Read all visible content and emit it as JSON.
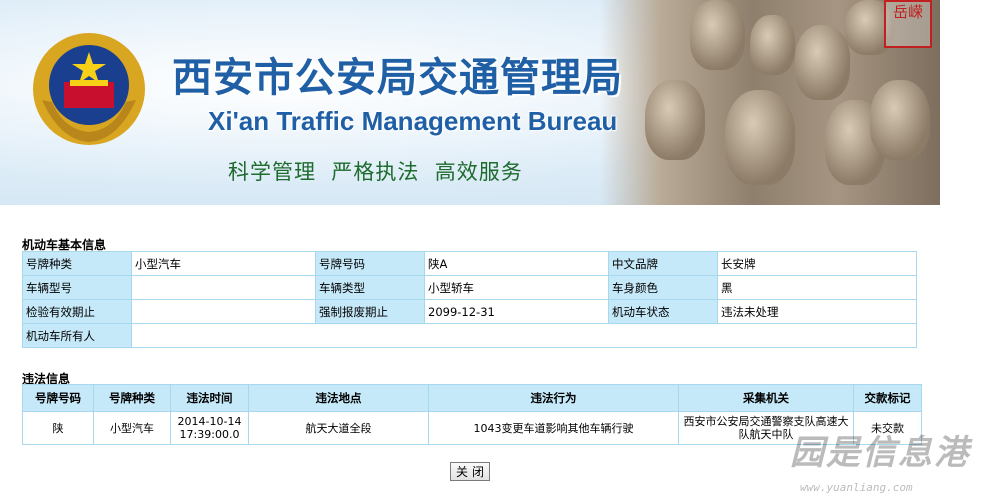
{
  "banner": {
    "title_cn": "西安市公安局交通管理局",
    "title_en": "Xi'an Traffic Management Bureau",
    "slogan": "科学管理  严格执法  高效服务",
    "seal_text": "岳嵘",
    "colors": {
      "title": "#1f5fa6",
      "slogan": "#1e6b2e",
      "seal": "#c02020"
    }
  },
  "vehicle": {
    "section_title": "机动车基本信息",
    "rows": [
      [
        {
          "label": "号牌种类",
          "value": "小型汽车"
        },
        {
          "label": "号牌号码",
          "value": "陕A"
        },
        {
          "label": "中文品牌",
          "value": "长安牌"
        }
      ],
      [
        {
          "label": "车辆型号",
          "value": ""
        },
        {
          "label": "车辆类型",
          "value": "小型轿车"
        },
        {
          "label": "车身颜色",
          "value": "黑"
        }
      ],
      [
        {
          "label": "检验有效期止",
          "value": ""
        },
        {
          "label": "强制报废期止",
          "value": "2099-12-31"
        },
        {
          "label": "机动车状态",
          "value": "违法未处理"
        }
      ]
    ],
    "owner_label": "机动车所有人",
    "owner_value": ""
  },
  "violations": {
    "section_title": "违法信息",
    "columns": [
      "号牌号码",
      "号牌种类",
      "违法时间",
      "违法地点",
      "违法行为",
      "采集机关",
      "交款标记"
    ],
    "rows": [
      {
        "plate": "陕",
        "plate_type": "小型汽车",
        "time_date": "2014-10-14",
        "time_clock": "17:39:00.0",
        "location": "航天大道全段",
        "behavior": "1043变更车道影响其他车辆行驶",
        "agency": "西安市公安局交通警察支队高速大队航天中队",
        "payment": "未交款"
      }
    ]
  },
  "close_label": "关闭",
  "watermark": {
    "text": "园是信息港",
    "url": "www.yuanliang.com"
  }
}
